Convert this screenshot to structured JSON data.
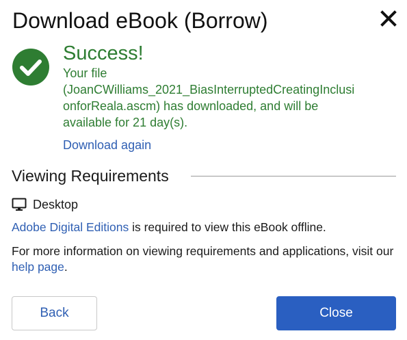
{
  "dialog": {
    "title": "Download eBook (Borrow)",
    "close_icon": "close-x-icon"
  },
  "success": {
    "icon": "check-circle-icon",
    "title": "Success!",
    "message_lines": [
      "Your file",
      "(JoanCWilliams_2021_BiasInterruptedCreatingInclusi",
      "onforReala.ascm) has downloaded, and will be",
      "available for 21 day(s)."
    ],
    "download_again_label": "Download again"
  },
  "requirements": {
    "heading": "Viewing Requirements",
    "platform_icon": "desktop-monitor-icon",
    "platform_label": "Desktop",
    "app_link": "Adobe Digital Editions",
    "app_text": " is required to view this eBook offline.",
    "info_text": "For more information on viewing requirements and applications, visit our ",
    "help_link": "help page",
    "info_end": "."
  },
  "buttons": {
    "back_label": "Back",
    "close_label": "Close"
  },
  "colors": {
    "success_green": "#2e7d32",
    "link_blue": "#2f5fb3",
    "primary_button": "#2a5fc1"
  }
}
